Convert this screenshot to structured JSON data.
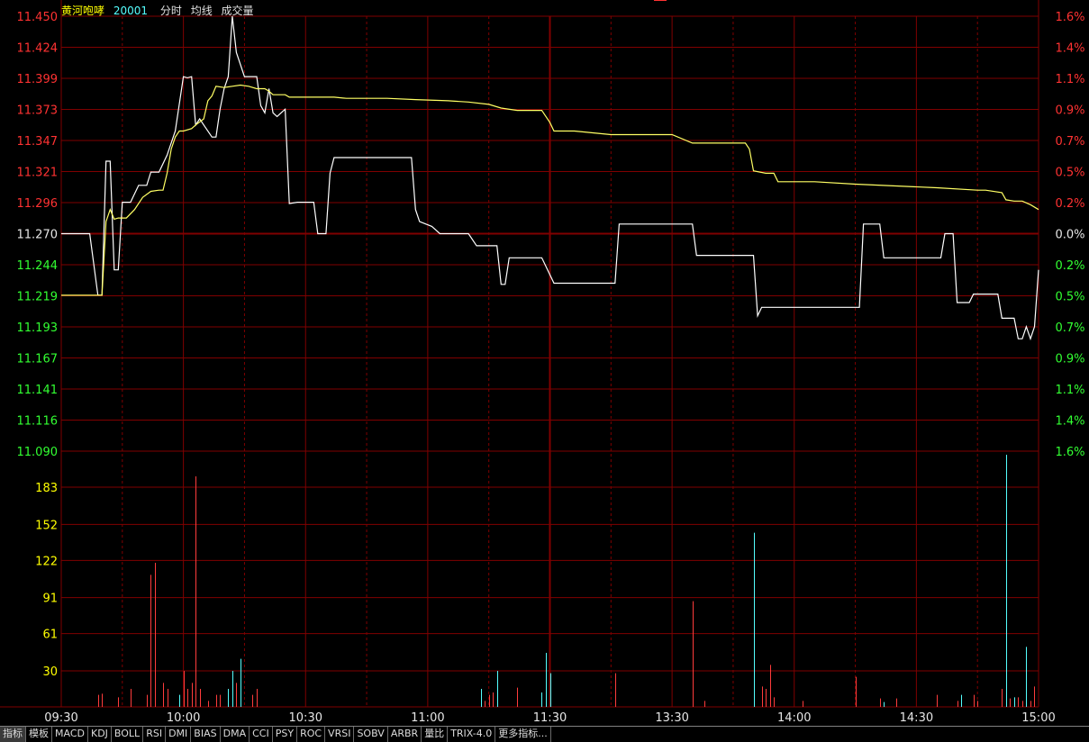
{
  "header": {
    "stock_name": "黄河咆哮",
    "stock_code": "20001",
    "labels": [
      "分时",
      "均线",
      "成交量"
    ]
  },
  "colors": {
    "grid": "#800000",
    "axis_up": "#ff3232",
    "axis_down": "#32ff32",
    "axis_flat": "#e6e6e6",
    "volume_axis": "#ffff00",
    "price_line": "#ffffff",
    "avg_line": "#ffff64",
    "vol_up": "#ff3c3c",
    "vol_down": "#54ffff"
  },
  "tabs": [
    "指标",
    "模板",
    "MACD",
    "KDJ",
    "BOLL",
    "RSI",
    "DMI",
    "BIAS",
    "DMA",
    "CCI",
    "PSY",
    "ROC",
    "VRSI",
    "SOBV",
    "ARBR",
    "量比",
    "TRIX-4.0",
    "更多指标..."
  ],
  "chart_data": {
    "type": "line",
    "prev_close": 11.27,
    "price_axis": {
      "ylim": [
        11.09,
        11.45
      ],
      "ticks": [
        "11.450",
        "11.424",
        "11.399",
        "11.373",
        "11.347",
        "11.321",
        "11.296",
        "11.270",
        "11.244",
        "11.219",
        "11.193",
        "11.167",
        "11.141",
        "11.116",
        "11.090"
      ],
      "pct_ticks": [
        "1.6%",
        "1.4%",
        "1.1%",
        "0.9%",
        "0.7%",
        "0.5%",
        "0.2%",
        "0.0%",
        "0.2%",
        "0.5%",
        "0.7%",
        "0.9%",
        "1.1%",
        "1.4%",
        "1.6%"
      ]
    },
    "time_axis": {
      "labels": [
        "09:30",
        "10:00",
        "10:30",
        "11:00",
        "11:30",
        "13:30",
        "14:00",
        "14:30",
        "15:00"
      ],
      "minutes": [
        0,
        30,
        60,
        90,
        120,
        150,
        180,
        210,
        240
      ]
    },
    "volume_axis": {
      "ylim": [
        0,
        213
      ],
      "ticks": [
        "183",
        "152",
        "122",
        "91",
        "61",
        "30"
      ]
    },
    "series": [
      {
        "name": "分时",
        "points": [
          [
            0,
            11.27
          ],
          [
            7,
            11.27
          ],
          [
            9,
            11.219
          ],
          [
            10,
            11.219
          ],
          [
            11,
            11.33
          ],
          [
            12,
            11.33
          ],
          [
            13,
            11.24
          ],
          [
            14,
            11.24
          ],
          [
            15,
            11.296
          ],
          [
            17,
            11.296
          ],
          [
            19,
            11.31
          ],
          [
            21,
            11.31
          ],
          [
            22,
            11.321
          ],
          [
            24,
            11.321
          ],
          [
            26,
            11.335
          ],
          [
            28,
            11.355
          ],
          [
            30,
            11.4
          ],
          [
            31,
            11.399
          ],
          [
            32,
            11.4
          ],
          [
            33,
            11.36
          ],
          [
            34,
            11.365
          ],
          [
            35,
            11.36
          ],
          [
            37,
            11.35
          ],
          [
            38,
            11.35
          ],
          [
            39,
            11.373
          ],
          [
            40,
            11.39
          ],
          [
            41,
            11.4
          ],
          [
            42,
            11.45
          ],
          [
            43,
            11.42
          ],
          [
            45,
            11.4
          ],
          [
            48,
            11.4
          ],
          [
            49,
            11.376
          ],
          [
            50,
            11.37
          ],
          [
            51,
            11.39
          ],
          [
            52,
            11.37
          ],
          [
            53,
            11.367
          ],
          [
            54,
            11.37
          ],
          [
            55,
            11.373
          ],
          [
            56,
            11.295
          ],
          [
            58,
            11.296
          ],
          [
            60,
            11.296
          ],
          [
            62,
            11.296
          ],
          [
            63,
            11.27
          ],
          [
            64,
            11.27
          ],
          [
            65,
            11.27
          ],
          [
            66,
            11.32
          ],
          [
            67,
            11.333
          ],
          [
            74,
            11.333
          ],
          [
            86,
            11.333
          ],
          [
            87,
            11.29
          ],
          [
            88,
            11.28
          ],
          [
            91,
            11.276
          ],
          [
            93,
            11.27
          ],
          [
            100,
            11.27
          ],
          [
            102,
            11.26
          ],
          [
            107,
            11.26
          ],
          [
            108,
            11.228
          ],
          [
            109,
            11.228
          ],
          [
            110,
            11.25
          ],
          [
            118,
            11.25
          ],
          [
            121,
            11.229
          ],
          [
            131,
            11.229
          ],
          [
            136,
            11.229
          ],
          [
            137,
            11.278
          ],
          [
            149,
            11.278
          ],
          [
            155,
            11.278
          ],
          [
            156,
            11.252
          ],
          [
            170,
            11.252
          ],
          [
            171,
            11.202
          ],
          [
            172,
            11.209
          ],
          [
            186,
            11.209
          ],
          [
            196,
            11.209
          ],
          [
            197,
            11.278
          ],
          [
            201,
            11.278
          ],
          [
            202,
            11.25
          ],
          [
            216,
            11.25
          ],
          [
            217,
            11.27
          ],
          [
            219,
            11.27
          ],
          [
            220,
            11.213
          ],
          [
            223,
            11.213
          ],
          [
            224,
            11.22
          ],
          [
            230,
            11.22
          ],
          [
            231,
            11.2
          ],
          [
            234,
            11.2
          ],
          [
            235,
            11.183
          ],
          [
            236,
            11.183
          ],
          [
            237,
            11.193
          ],
          [
            238,
            11.183
          ],
          [
            239,
            11.193
          ],
          [
            240,
            11.24
          ]
        ]
      },
      {
        "name": "均线",
        "points": [
          [
            0,
            11.219
          ],
          [
            10,
            11.219
          ],
          [
            11,
            11.28
          ],
          [
            12,
            11.29
          ],
          [
            13,
            11.282
          ],
          [
            14,
            11.283
          ],
          [
            16,
            11.283
          ],
          [
            18,
            11.29
          ],
          [
            20,
            11.3
          ],
          [
            22,
            11.305
          ],
          [
            24,
            11.306
          ],
          [
            25,
            11.306
          ],
          [
            26,
            11.32
          ],
          [
            27,
            11.34
          ],
          [
            28,
            11.35
          ],
          [
            29,
            11.355
          ],
          [
            30,
            11.355
          ],
          [
            32,
            11.357
          ],
          [
            33,
            11.36
          ],
          [
            35,
            11.365
          ],
          [
            36,
            11.38
          ],
          [
            37,
            11.384
          ],
          [
            38,
            11.392
          ],
          [
            40,
            11.391
          ],
          [
            42,
            11.392
          ],
          [
            44,
            11.393
          ],
          [
            46,
            11.392
          ],
          [
            48,
            11.39
          ],
          [
            50,
            11.39
          ],
          [
            51,
            11.388
          ],
          [
            52,
            11.385
          ],
          [
            55,
            11.385
          ],
          [
            56,
            11.383
          ],
          [
            60,
            11.383
          ],
          [
            67,
            11.383
          ],
          [
            70,
            11.382
          ],
          [
            80,
            11.382
          ],
          [
            87,
            11.381
          ],
          [
            95,
            11.38
          ],
          [
            100,
            11.379
          ],
          [
            105,
            11.377
          ],
          [
            108,
            11.374
          ],
          [
            112,
            11.372
          ],
          [
            118,
            11.372
          ],
          [
            120,
            11.362
          ],
          [
            121,
            11.355
          ],
          [
            126,
            11.355
          ],
          [
            135,
            11.352
          ],
          [
            140,
            11.352
          ],
          [
            145,
            11.352
          ],
          [
            150,
            11.352
          ],
          [
            155,
            11.345
          ],
          [
            168,
            11.345
          ],
          [
            169,
            11.34
          ],
          [
            170,
            11.322
          ],
          [
            173,
            11.32
          ],
          [
            175,
            11.32
          ],
          [
            176,
            11.313
          ],
          [
            185,
            11.313
          ],
          [
            195,
            11.311
          ],
          [
            215,
            11.308
          ],
          [
            225,
            11.306
          ],
          [
            227,
            11.306
          ],
          [
            231,
            11.304
          ],
          [
            232,
            11.298
          ],
          [
            234,
            11.297
          ],
          [
            236,
            11.297
          ],
          [
            238,
            11.294
          ],
          [
            240,
            11.29
          ]
        ]
      }
    ],
    "volume": [
      [
        9,
        10,
        "up"
      ],
      [
        10,
        11,
        "up"
      ],
      [
        14,
        8,
        "up"
      ],
      [
        17,
        15,
        "up"
      ],
      [
        21,
        10,
        "up"
      ],
      [
        22,
        110,
        "up"
      ],
      [
        23,
        120,
        "up"
      ],
      [
        25,
        20,
        "up"
      ],
      [
        26,
        15,
        "up"
      ],
      [
        29,
        10,
        "down"
      ],
      [
        30,
        30,
        "up"
      ],
      [
        31,
        15,
        "up"
      ],
      [
        32,
        20,
        "up"
      ],
      [
        33,
        192,
        "up"
      ],
      [
        34,
        15,
        "up"
      ],
      [
        36,
        5,
        "up"
      ],
      [
        38,
        10,
        "up"
      ],
      [
        39,
        10,
        "up"
      ],
      [
        41,
        15,
        "down"
      ],
      [
        42,
        30,
        "down"
      ],
      [
        43,
        20,
        "up"
      ],
      [
        44,
        40,
        "down"
      ],
      [
        47,
        10,
        "up"
      ],
      [
        48,
        15,
        "up"
      ],
      [
        103,
        15,
        "down"
      ],
      [
        104,
        5,
        "up"
      ],
      [
        105,
        10,
        "up"
      ],
      [
        106,
        12,
        "up"
      ],
      [
        107,
        30,
        "down"
      ],
      [
        112,
        16,
        "up"
      ],
      [
        118,
        12,
        "down"
      ],
      [
        119,
        45,
        "down"
      ],
      [
        120,
        28,
        "down"
      ],
      [
        136,
        28,
        "up"
      ],
      [
        155,
        88,
        "up"
      ],
      [
        158,
        5,
        "up"
      ],
      [
        170,
        145,
        "down"
      ],
      [
        172,
        17,
        "up"
      ],
      [
        173,
        15,
        "up"
      ],
      [
        174,
        35,
        "up"
      ],
      [
        175,
        8,
        "up"
      ],
      [
        182,
        5,
        "up"
      ],
      [
        195,
        25,
        "up"
      ],
      [
        201,
        7,
        "up"
      ],
      [
        202,
        4,
        "down"
      ],
      [
        205,
        7,
        "up"
      ],
      [
        215,
        10,
        "up"
      ],
      [
        220,
        5,
        "up"
      ],
      [
        221,
        10,
        "down"
      ],
      [
        224,
        10,
        "up"
      ],
      [
        225,
        5,
        "up"
      ],
      [
        231,
        15,
        "up"
      ],
      [
        232,
        210,
        "down"
      ],
      [
        233,
        7,
        "up"
      ],
      [
        234,
        8,
        "down"
      ],
      [
        235,
        8,
        "up"
      ],
      [
        236,
        5,
        "up"
      ],
      [
        237,
        50,
        "down"
      ],
      [
        238,
        5,
        "up"
      ],
      [
        239,
        17,
        "up"
      ]
    ]
  }
}
